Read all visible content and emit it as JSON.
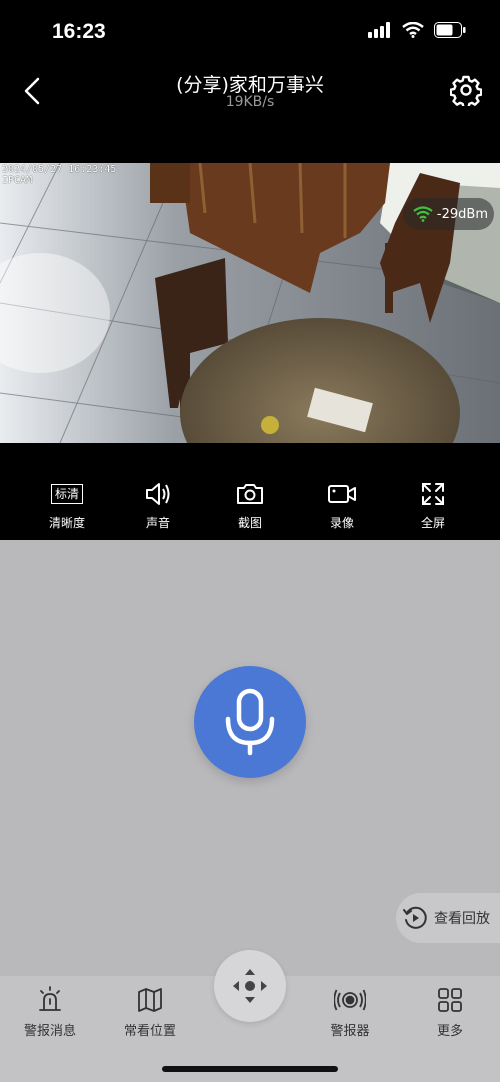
{
  "status_bar": {
    "time": "16:23"
  },
  "nav": {
    "title": "(分享)家和万事兴",
    "subtitle": "19KB/s"
  },
  "video": {
    "timestamp": "2024/05/27 16:23:45",
    "camera_name": "IPCAM",
    "signal": "-29dBm"
  },
  "controls": [
    {
      "label": "清晰度",
      "badge": "标清",
      "icon": "quality-icon"
    },
    {
      "label": "声音",
      "icon": "speaker-icon"
    },
    {
      "label": "截图",
      "icon": "camera-icon"
    },
    {
      "label": "录像",
      "icon": "video-record-icon"
    },
    {
      "label": "全屏",
      "icon": "fullscreen-icon"
    }
  ],
  "playback": {
    "label": "查看回放"
  },
  "bottom_tabs": [
    {
      "label": "警报消息",
      "icon": "alarm-light-icon"
    },
    {
      "label": "常看位置",
      "icon": "map-icon"
    },
    {
      "label": "警报器",
      "icon": "siren-icon"
    },
    {
      "label": "更多",
      "icon": "grid-icon"
    }
  ],
  "colors": {
    "accent": "#4a78d4",
    "background": "#b9b9bc",
    "signal": "#3fc23f"
  }
}
